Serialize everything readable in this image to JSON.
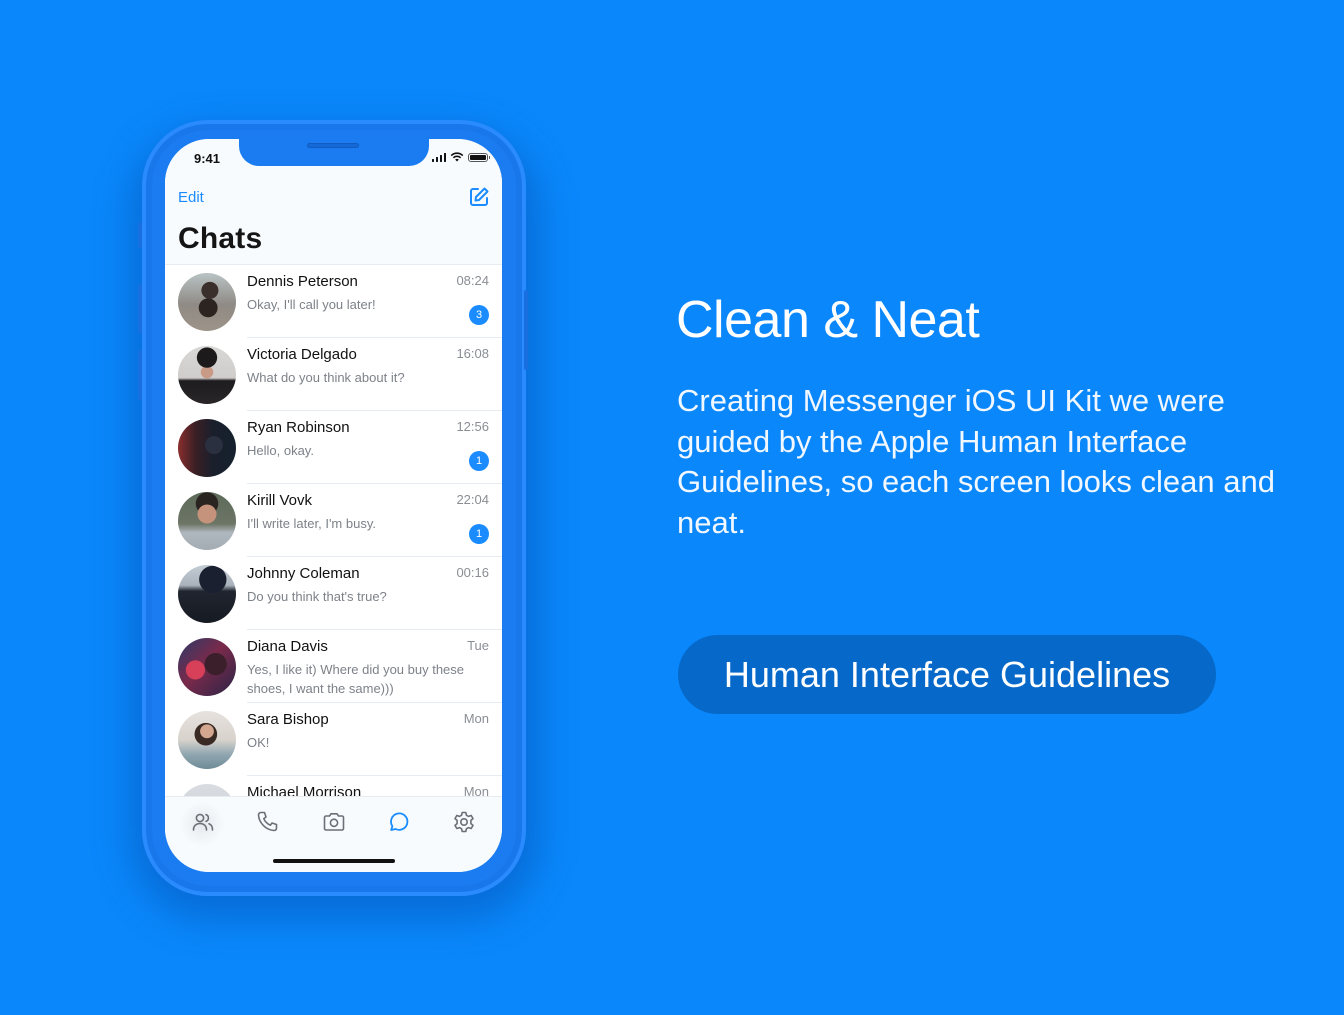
{
  "colors": {
    "background": "#0a87fb",
    "accent": "#1a8cff",
    "button_bg": "#0669c9"
  },
  "phone": {
    "status_bar": {
      "time": "9:41",
      "signal_icon": "cellular-signal-icon",
      "wifi_icon": "wifi-icon",
      "battery_icon": "battery-icon"
    },
    "header": {
      "edit_label": "Edit",
      "compose_icon": "compose-icon",
      "title": "Chats"
    },
    "chats": [
      {
        "name": "Dennis Peterson",
        "message": "Okay, I'll call you later!",
        "time": "08:24",
        "unread": "3"
      },
      {
        "name": "Victoria Delgado",
        "message": "What do you think about it?",
        "time": "16:08",
        "unread": null
      },
      {
        "name": "Ryan Robinson",
        "message": "Hello, okay.",
        "time": "12:56",
        "unread": "1"
      },
      {
        "name": "Kirill Vovk",
        "message": "I'll write later, I'm busy.",
        "time": "22:04",
        "unread": "1"
      },
      {
        "name": "Johnny Coleman",
        "message": "Do you think that's true?",
        "time": "00:16",
        "unread": null
      },
      {
        "name": "Diana Davis",
        "message": "Yes, I like it) Where did you buy these shoes, I want the same)))",
        "time": "Tue",
        "unread": null
      },
      {
        "name": "Sara Bishop",
        "message": "OK!",
        "time": "Mon",
        "unread": null
      },
      {
        "name": "Michael Morrison",
        "message": "",
        "time": "Mon",
        "unread": null
      }
    ],
    "tab_bar": [
      {
        "icon": "contacts-icon",
        "active": false
      },
      {
        "icon": "phone-icon",
        "active": false
      },
      {
        "icon": "camera-icon",
        "active": false
      },
      {
        "icon": "chat-bubble-icon",
        "active": true
      },
      {
        "icon": "settings-gear-icon",
        "active": false
      }
    ]
  },
  "promo": {
    "heading": "Clean & Neat",
    "description": "Creating Messenger iOS UI Kit we were guided by the Apple Human Interface Guidelines, so each screen looks clean and neat.",
    "button_label": "Human Interface Guidelines"
  }
}
